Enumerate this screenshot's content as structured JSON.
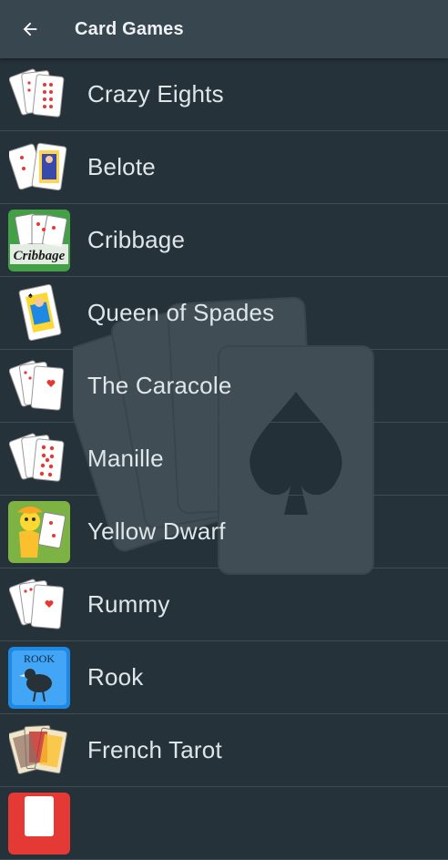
{
  "appbar": {
    "title": "Card Games",
    "back_icon": "arrow-left-icon"
  },
  "games": [
    {
      "label": "Crazy Eights",
      "icon": "hearts-fan-icon"
    },
    {
      "label": "Belote",
      "icon": "jack-card-icon"
    },
    {
      "label": "Cribbage",
      "icon": "cribbage-board-icon",
      "icon_text": "Cribbage"
    },
    {
      "label": "Queen of Spades",
      "icon": "queen-card-icon"
    },
    {
      "label": "The Caracole",
      "icon": "hearts-fan-icon"
    },
    {
      "label": "Manille",
      "icon": "hearts-fan-icon"
    },
    {
      "label": "Yellow Dwarf",
      "icon": "yellow-dwarf-icon"
    },
    {
      "label": "Rummy",
      "icon": "hearts-fan-icon"
    },
    {
      "label": "Rook",
      "icon": "rook-bird-icon",
      "icon_text": "ROOK"
    },
    {
      "label": "French Tarot",
      "icon": "tarot-cards-icon"
    },
    {
      "label": "",
      "icon": "red-card-icon"
    }
  ],
  "colors": {
    "background": "#25323a",
    "appbar": "#37464f",
    "text": "#dfe6ea",
    "divider": "#3d4d56"
  }
}
